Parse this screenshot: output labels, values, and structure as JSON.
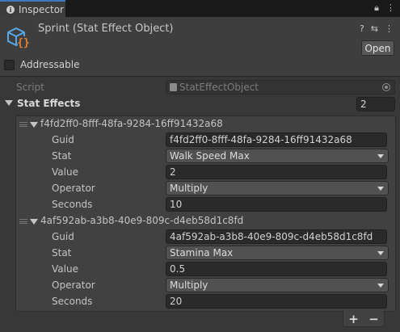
{
  "tab": {
    "title": "Inspector",
    "icon": "info-icon"
  },
  "header": {
    "title": "Sprint (Stat Effect Object)",
    "icon": "scriptable-object-icon",
    "open_label": "Open",
    "addressable_label": "Addressable",
    "addressable_checked": false
  },
  "script": {
    "label": "Script",
    "value": "StatEffectObject"
  },
  "stat_effects": {
    "label": "Stat Effects",
    "count": "2",
    "items": [
      {
        "id": "f4fd2ff0-8fff-48fa-9284-16ff91432a68",
        "guid_label": "Guid",
        "guid": "f4fd2ff0-8fff-48fa-9284-16ff91432a68",
        "stat_label": "Stat",
        "stat": "Walk Speed Max",
        "value_label": "Value",
        "value": "2",
        "operator_label": "Operator",
        "operator": "Multiply",
        "seconds_label": "Seconds",
        "seconds": "10"
      },
      {
        "id": "4af592ab-a3b8-40e9-809c-d4eb58d1c8fd",
        "guid_label": "Guid",
        "guid": "4af592ab-a3b8-40e9-809c-d4eb58d1c8fd",
        "stat_label": "Stat",
        "stat": "Stamina Max",
        "value_label": "Value",
        "value": "0.5",
        "operator_label": "Operator",
        "operator": "Multiply",
        "seconds_label": "Seconds",
        "seconds": "20"
      }
    ],
    "add_label": "+",
    "remove_label": "−"
  },
  "colors": {
    "accent": "#3a79bb",
    "icon_blue": "#58a6e6",
    "icon_orange": "#e8812f"
  }
}
